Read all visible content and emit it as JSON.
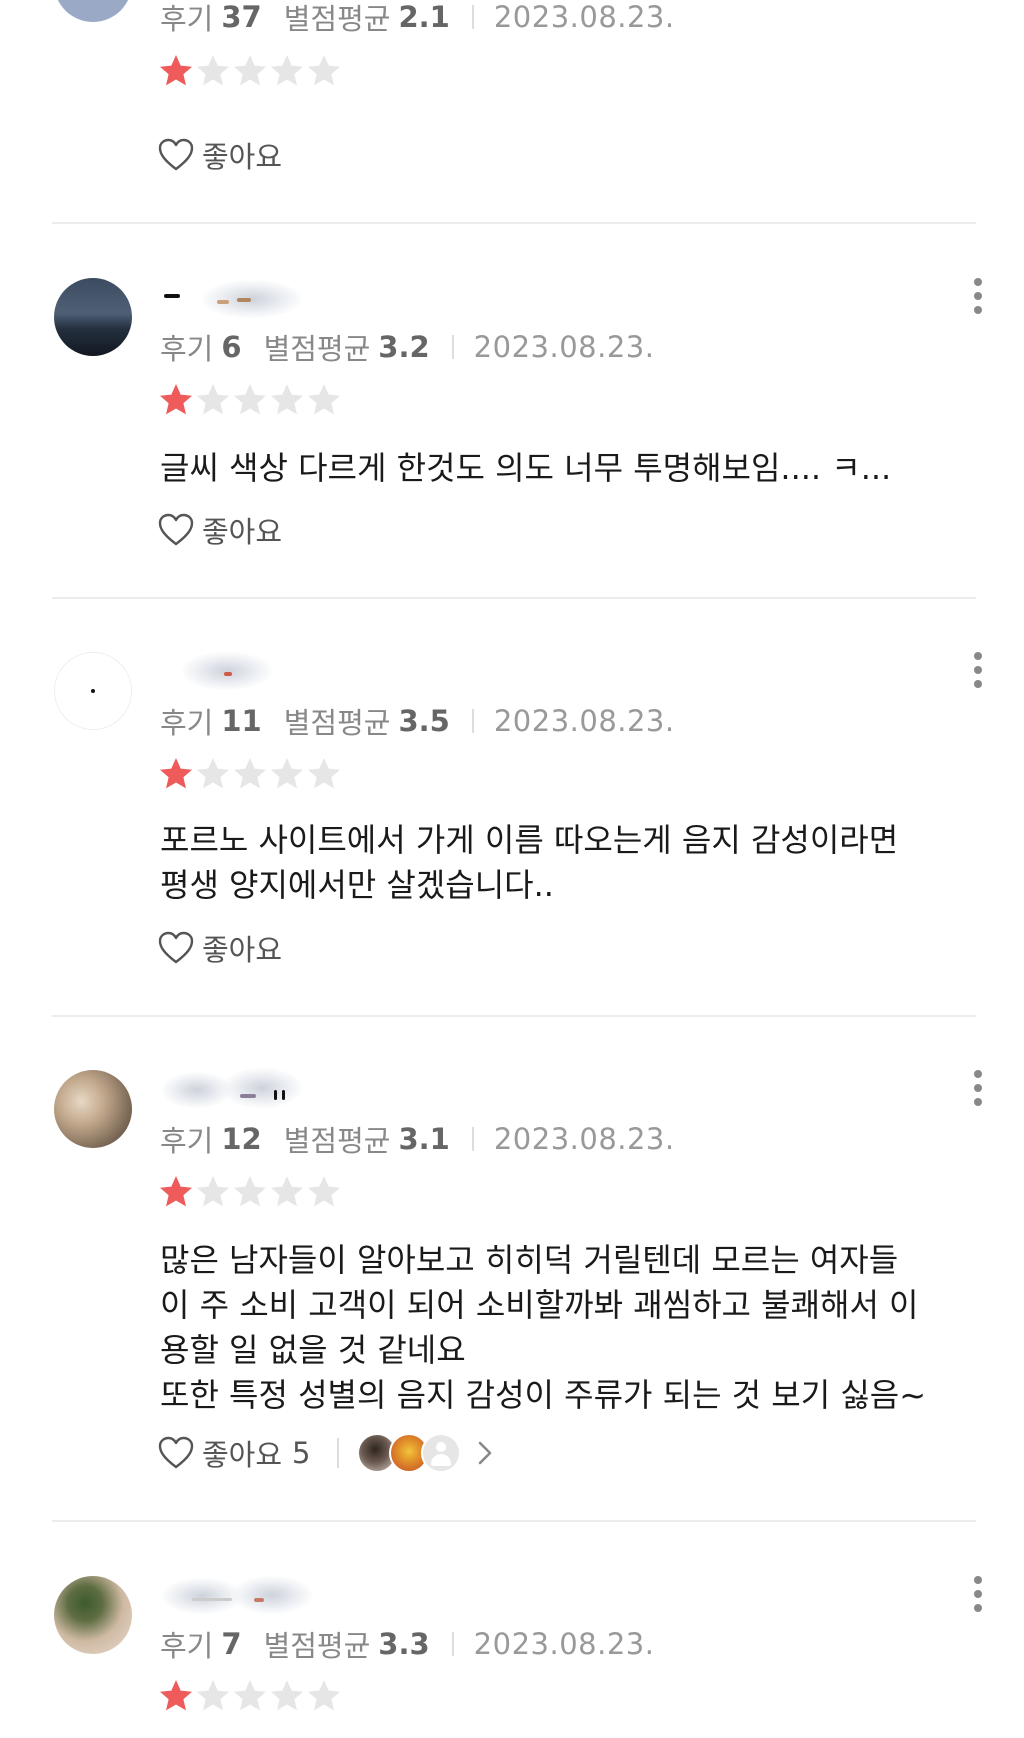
{
  "meta_labels": {
    "reviews": "후기",
    "average_rating": "별점평균"
  },
  "like_label": "좋아요",
  "colors": {
    "star_filled": "#ef5b5b",
    "star_empty": "#e6e6e6",
    "divider": "#ececec"
  },
  "reviews": [
    {
      "review_count": "37",
      "avg_rating": "2.1",
      "date": "2023.08.23.",
      "stars": 1,
      "text": "",
      "likes": ""
    },
    {
      "review_count": "6",
      "avg_rating": "3.2",
      "date": "2023.08.23.",
      "stars": 1,
      "text": "글씨 색상 다르게 한것도 의도 너무 투명해보임.... ㅋ...",
      "likes": ""
    },
    {
      "review_count": "11",
      "avg_rating": "3.5",
      "date": "2023.08.23.",
      "stars": 1,
      "text": "포르노 사이트에서 가게 이름 따오는게 음지 감성이라면\n평생 양지에서만 살겠습니다..",
      "likes": ""
    },
    {
      "review_count": "12",
      "avg_rating": "3.1",
      "date": "2023.08.23.",
      "stars": 1,
      "text": "많은 남자들이 알아보고 히히덕 거릴텐데 모르는 여자들\n이 주 소비 고객이 되어 소비할까봐 괘씸하고 불쾌해서 이\n용할 일 없을 것 같네요\n또한 특정 성별의 음지 감성이 주류가 되는 것 보기 싫음~",
      "likes": "5"
    },
    {
      "review_count": "7",
      "avg_rating": "3.3",
      "date": "2023.08.23.",
      "stars": 1,
      "text": "",
      "likes": ""
    }
  ]
}
